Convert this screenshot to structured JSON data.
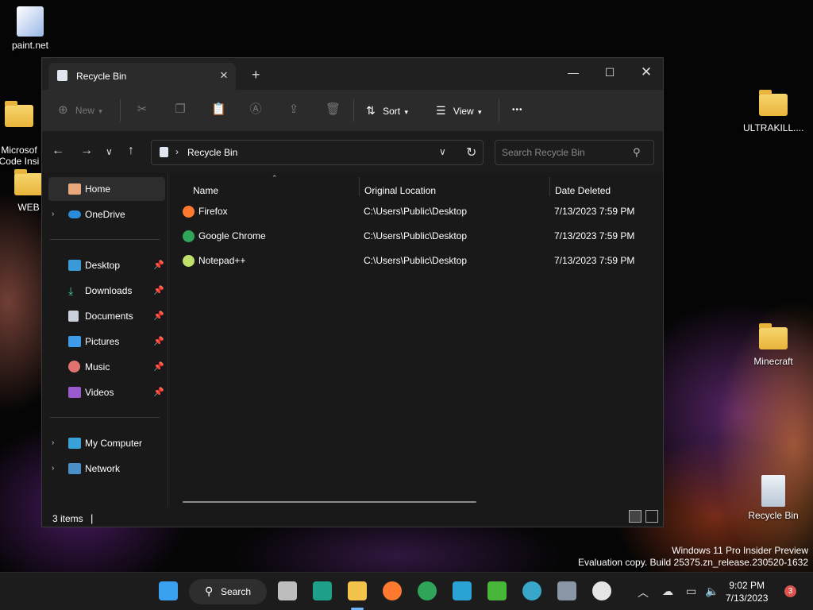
{
  "desktop": {
    "icons": [
      {
        "label": "paint.net"
      },
      {
        "label": "Microsof\nCode Insi"
      },
      {
        "label": "WEB"
      },
      {
        "label": "ULTRAKILL...."
      },
      {
        "label": "Minecraft"
      },
      {
        "label": "Recycle Bin"
      }
    ],
    "watermark_line1": "Windows 11 Pro Insider Preview",
    "watermark_line2": "Evaluation copy. Build 25375.zn_release.230520-1632"
  },
  "window": {
    "tab_title": "Recycle Bin",
    "toolbar": {
      "new_label": "New",
      "sort_label": "Sort",
      "view_label": "View",
      "more_label": "•••"
    },
    "address": {
      "path": "Recycle Bin"
    },
    "search": {
      "placeholder": "Search Recycle Bin"
    },
    "sidebar": {
      "items": [
        {
          "label": "Home"
        },
        {
          "label": "OneDrive"
        },
        {
          "label": "Desktop"
        },
        {
          "label": "Downloads"
        },
        {
          "label": "Documents"
        },
        {
          "label": "Pictures"
        },
        {
          "label": "Music"
        },
        {
          "label": "Videos"
        },
        {
          "label": "My Computer"
        },
        {
          "label": "Network"
        }
      ]
    },
    "columns": {
      "name": "Name",
      "location": "Original Location",
      "date": "Date Deleted"
    },
    "rows": [
      {
        "name": "Firefox",
        "location": "C:\\Users\\Public\\Desktop",
        "date": "7/13/2023 7:59 PM"
      },
      {
        "name": "Google Chrome",
        "location": "C:\\Users\\Public\\Desktop",
        "date": "7/13/2023 7:59 PM"
      },
      {
        "name": "Notepad++",
        "location": "C:\\Users\\Public\\Desktop",
        "date": "7/13/2023 7:59 PM"
      }
    ],
    "status": {
      "count": "3 items"
    }
  },
  "taskbar": {
    "search_label": "Search",
    "time": "9:02 PM",
    "date": "7/13/2023",
    "notification_count": "3"
  }
}
